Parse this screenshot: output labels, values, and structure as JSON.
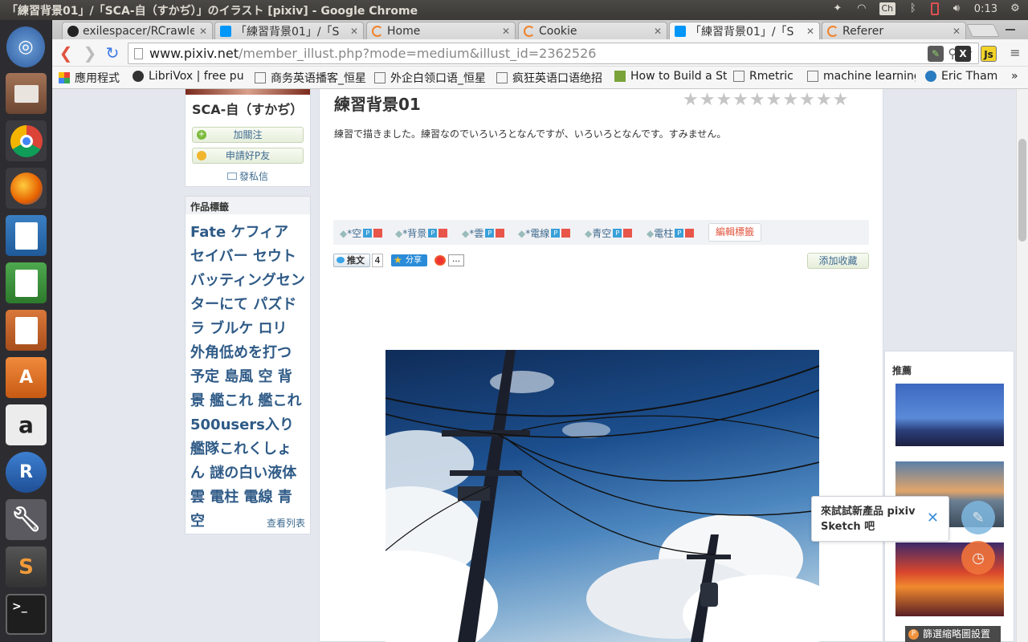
{
  "window": {
    "title": "「練習背景01」/「SCA-自（すかぢ）」のイラスト [pixiv] - Google Chrome"
  },
  "tray": {
    "keyboard": "Ch",
    "time": "0:13"
  },
  "tabs": [
    {
      "label": "exilespacer/RCrawle",
      "favicon": "github-icon",
      "active": false
    },
    {
      "label": "「練習背景01」/「S",
      "favicon": "pixiv-icon",
      "active": false
    },
    {
      "label": "Home",
      "favicon": "loading-icon",
      "active": false
    },
    {
      "label": "Cookie",
      "favicon": "loading-icon",
      "active": false
    },
    {
      "label": "「練習背景01」/「S",
      "favicon": "pixiv-icon",
      "active": true
    },
    {
      "label": "Referer",
      "favicon": "loading-icon",
      "active": false
    }
  ],
  "address": {
    "host": "www.pixiv.net",
    "path": "/member_illust.php?mode=medium&illust_id=2362526"
  },
  "bookmarks": [
    {
      "label": "應用程式",
      "icon": "apps-grid-icon"
    },
    {
      "label": "LibriVox | free pu",
      "icon": "librivox-icon"
    },
    {
      "label": "商务英语播客_恒星",
      "icon": "page-icon"
    },
    {
      "label": "外企白领口语_恒星",
      "icon": "page-icon"
    },
    {
      "label": "疯狂英语口语绝招",
      "icon": "page-icon"
    },
    {
      "label": "How to Build a St",
      "icon": "hackernews-icon"
    },
    {
      "label": "Rmetric",
      "icon": "page-icon"
    },
    {
      "label": "machine learning",
      "icon": "page-icon"
    },
    {
      "label": "Eric Tham",
      "icon": "wordpress-icon"
    }
  ],
  "profile": {
    "name": "SCA-自（すかぢ）",
    "follow": "加關注",
    "friend": "申請好P友",
    "message": "發私信"
  },
  "tag_panel": {
    "header": "作品標籤",
    "tags": "Fate ケフィア セイバー セウト バッティングセンターにて パズドラ ブルケ ロリ 外角低めを打つ予定 島風 空 背景 艦これ 艦これ500users入り 艦隊これくしょん 謎の白い液体 雲 電柱 電線 青空",
    "view_all": "查看列表"
  },
  "illust": {
    "title": "練習背景01",
    "caption": "練習で描きました。練習なのでいろいろとなんですが、いろいろとなんです。すみません。",
    "rating_stars": 10,
    "tags": [
      "*空",
      "*背景",
      "*雲",
      "*電線",
      "青空",
      "電柱"
    ],
    "edit_tags": "編輯標籤",
    "tweet": "推文",
    "tweet_count": "4",
    "share": "分享",
    "more": "…",
    "bookmark": "添加收藏"
  },
  "recommend": {
    "header": "推薦",
    "settings": "篩選縮略圖設置"
  },
  "sketch_popup": {
    "text": "來試試新產品 pixiv Sketch 吧"
  },
  "colors": {
    "pixiv_blue": "#2f5b87",
    "launcher_bg": "#2d2d31",
    "page_bg": "#e4e7ee",
    "edit_red": "#e0553f",
    "sketch_orange": "#f0733a"
  }
}
